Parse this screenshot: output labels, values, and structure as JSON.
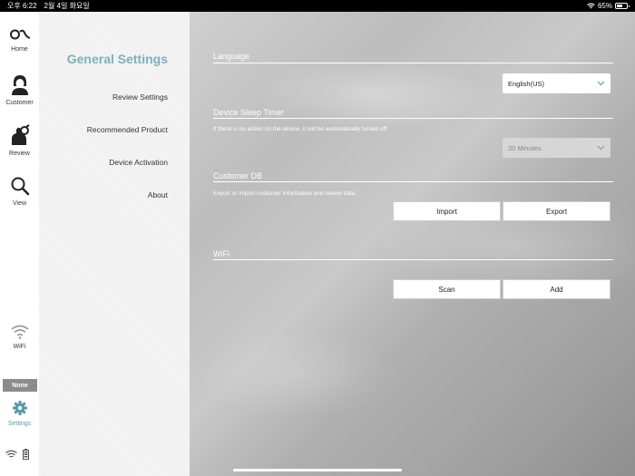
{
  "status_bar": {
    "time": "오후 6:22",
    "date": "2월 4일 화요일",
    "battery": "65%"
  },
  "nav": {
    "home": "Home",
    "customer": "Customer",
    "review": "Review",
    "view": "View",
    "wifi": "WiFi",
    "none_badge": "None",
    "settings": "Settings"
  },
  "menu": {
    "title": "General Settings",
    "items": [
      "Review Settings",
      "Recommended Product",
      "Device Activation",
      "About"
    ]
  },
  "content": {
    "language": {
      "title": "Language",
      "selected": "English(US)"
    },
    "sleep": {
      "title": "Device Sleep Timer",
      "desc": "If there is no action on the device, it will be automatically turned off.",
      "selected": "20 Minutes"
    },
    "customer_db": {
      "title": "Customer DB",
      "desc": "Export or import customer information and review data.",
      "import_label": "Import",
      "export_label": "Export"
    },
    "wifi": {
      "title": "WiFi",
      "scan_label": "Scan",
      "add_label": "Add"
    }
  },
  "colors": {
    "accent": "#5a9aa9",
    "menu_title": "#7fb0bc"
  }
}
